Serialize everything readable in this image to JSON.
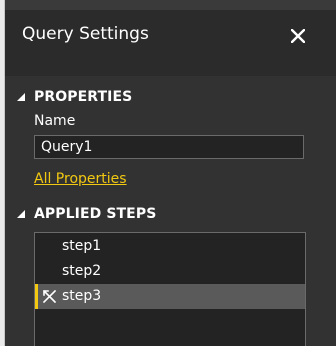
{
  "panel": {
    "title": "Query Settings",
    "close_icon": "close-icon"
  },
  "properties": {
    "header": "PROPERTIES",
    "name_label": "Name",
    "name_value": "Query1",
    "all_properties_link": "All Properties"
  },
  "applied_steps": {
    "header": "APPLIED STEPS",
    "steps": [
      {
        "label": "step1",
        "selected": false
      },
      {
        "label": "step2",
        "selected": false
      },
      {
        "label": "step3",
        "selected": true
      }
    ]
  },
  "colors": {
    "panel_bg": "#323232",
    "header_bg": "#2b2b2b",
    "accent": "#f2c811",
    "input_bg": "#232323",
    "selected_row": "#5a5a5a"
  }
}
